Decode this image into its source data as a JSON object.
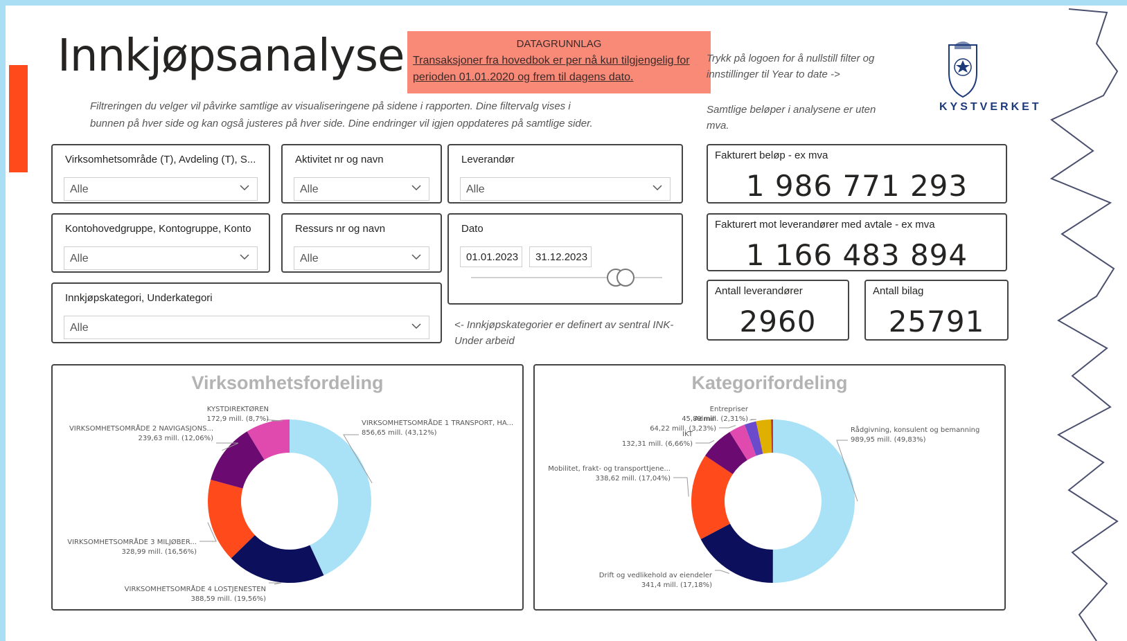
{
  "header": {
    "title": "Innkjøpsanalyser",
    "notice_heading": "DATAGRUNNLAG",
    "notice_text": "Transaksjoner fra hovedbok er per nå kun tilgjengelig for perioden 01.01.2020 og frem til dagens dato.",
    "intro_line1": "Filtreringen du velger vil påvirke samtlige av visualiseringene på sidene i rapporten. Dine filtervalg vises i",
    "intro_line2": "bunnen på hver side og kan også justeres på hver side. Dine endringer vil igjen oppdateres på samtlige sider.",
    "reset_hint_line1": "Trykk på logoen for å nullstill filter og",
    "reset_hint_line2": "innstillinger til Year to date ->",
    "mva_line1": "Samtlige beløper i analysene er uten",
    "mva_line2": "mva.",
    "logo_text": "KYSTVERKET"
  },
  "filters": {
    "virksomhet": {
      "label": "Virksomhetsområde (T), Avdeling (T), S...",
      "value": "Alle"
    },
    "aktivitet": {
      "label": "Aktivitet nr og navn",
      "value": "Alle"
    },
    "leverandor": {
      "label": "Leverandør",
      "value": "Alle"
    },
    "konto": {
      "label": "Kontohovedgruppe, Kontogruppe, Konto",
      "value": "Alle"
    },
    "ressurs": {
      "label": "Ressurs nr og navn",
      "value": "Alle"
    },
    "kategori": {
      "label": "Innkjøpskategori, Underkategori",
      "value": "Alle"
    },
    "dato": {
      "label": "Dato",
      "from": "01.01.2023",
      "to": "31.12.2023"
    },
    "category_note_line1": "<- Innkjøpskategorier er definert av sentral INK-",
    "category_note_line2": "Under arbeid"
  },
  "kpis": {
    "fakturert": {
      "label": "Fakturert beløp - ex mva",
      "value": "1 986 771 293"
    },
    "fakturert_avtale": {
      "label": "Fakturert mot leverandører med avtale - ex mva",
      "value": "1 166 483 894"
    },
    "antall_leverandorer": {
      "label": "Antall leverandører",
      "value": "2960"
    },
    "antall_bilag": {
      "label": "Antall bilag",
      "value": "25791"
    }
  },
  "chart_data": [
    {
      "type": "pie",
      "title": "Virksomhetsfordeling",
      "series": [
        {
          "name": "VIRKSOMHETSOMRÅDE 1 TRANSPORT, HA...",
          "value": 856.65,
          "label": "856,65 mill. (43,12%)",
          "color": "#a9e1f7"
        },
        {
          "name": "VIRKSOMHETSOMRÅDE 4 LOSTJENESTEN",
          "value": 388.59,
          "label": "388,59 mill. (19,56%)",
          "color": "#0c0f5c"
        },
        {
          "name": "VIRKSOMHETSOMRÅDE 3 MILJØBER...",
          "value": 328.99,
          "label": "328,99 mill. (16,56%)",
          "color": "#ff4a1c"
        },
        {
          "name": "VIRKSOMHETSOMRÅDE 2 NAVIGASJONS...",
          "value": 239.63,
          "label": "239,63 mill. (12,06%)",
          "color": "#6b0a70"
        },
        {
          "name": "KYSTDIREKTØREN",
          "value": 172.9,
          "label": "172,9 mill. (8,7%)",
          "color": "#e04aae"
        }
      ]
    },
    {
      "type": "pie",
      "title": "Kategorifordeling",
      "series": [
        {
          "name": "Rådgivning, konsulent og bemanning",
          "value": 989.95,
          "label": "989,95 mill. (49,83%)",
          "color": "#a9e1f7"
        },
        {
          "name": "Drift og vedlikehold av eiendeler",
          "value": 341.4,
          "label": "341,4 mill. (17,18%)",
          "color": "#0c0f5c"
        },
        {
          "name": "Mobilitet, frakt- og transporttjene...",
          "value": 338.62,
          "label": "338,62 mill. (17,04%)",
          "color": "#ff4a1c"
        },
        {
          "name": "IKT",
          "value": 132.31,
          "label": "132,31 mill. (6,66%)",
          "color": "#6b0a70"
        },
        {
          "name": "Admin",
          "value": 64.22,
          "label": "64,22 mill. (3,23%)",
          "color": "#e04aae"
        },
        {
          "name": "Entrepriser",
          "value": 45.89,
          "label": "45,89 mill. (2,31%)",
          "color": "#6b4acb"
        },
        {
          "name": "",
          "value": 58.0,
          "label": "",
          "color": "#e0b000"
        },
        {
          "name": "",
          "value": 8.0,
          "label": "",
          "color": "#c0392b"
        }
      ]
    }
  ]
}
